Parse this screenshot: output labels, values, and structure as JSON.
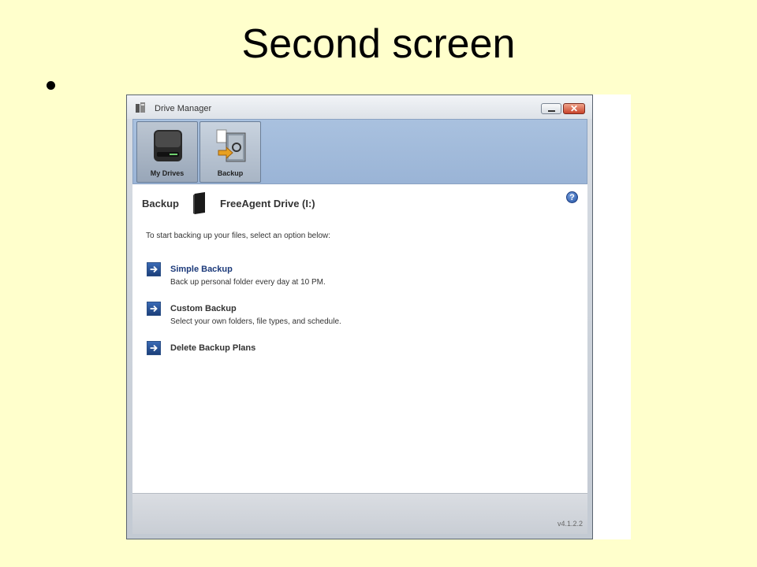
{
  "slide": {
    "title": "Second screen"
  },
  "window": {
    "title": "Drive Manager",
    "close_glyph": "✕",
    "toolbar": {
      "my_drives": "My Drives",
      "backup": "Backup"
    },
    "header": {
      "section": "Backup",
      "drive": "FreeAgent Drive (I:)",
      "help_glyph": "?"
    },
    "instruction": "To start backing up your files, select an option below:",
    "options": [
      {
        "title": "Simple Backup",
        "description": "Back up personal folder every day at 10 PM."
      },
      {
        "title": "Custom Backup",
        "description": "Select your own folders, file types, and schedule."
      },
      {
        "title": "Delete Backup Plans"
      }
    ],
    "version": "v4.1.2.2"
  },
  "colors": {
    "slide_background": "#ffffcc",
    "toolbar": "#a9c1df",
    "link_primary": "#1c3a7a",
    "arrow_button": "#2a5aa5"
  },
  "icons": [
    "app-icon",
    "minimize-icon",
    "close-icon",
    "drive-icon",
    "backup-vault-icon",
    "help-icon",
    "arrow-right-icon"
  ]
}
